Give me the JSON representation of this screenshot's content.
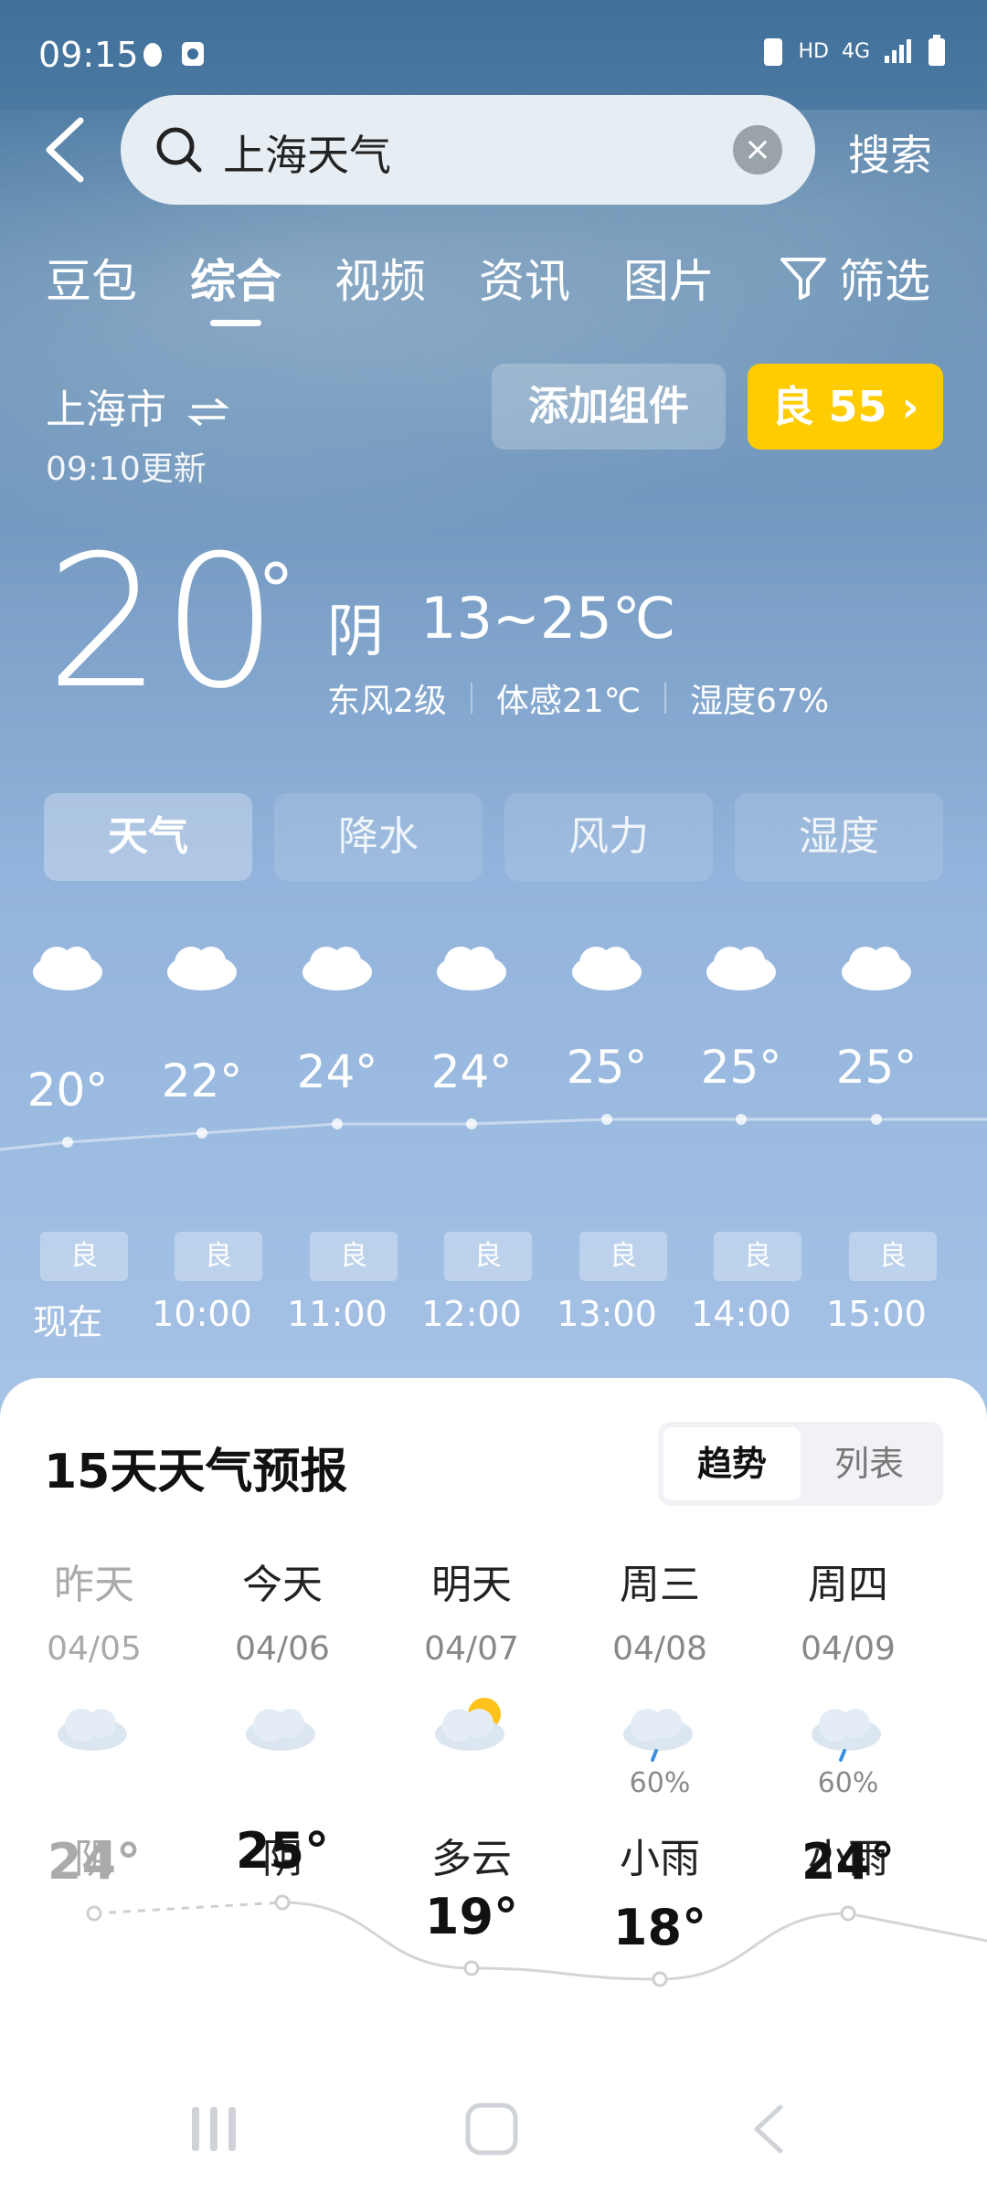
{
  "status": {
    "time": "09:15",
    "net1": "HD",
    "net2": "4G"
  },
  "search": {
    "query": "上海天气",
    "button": "搜索"
  },
  "tabs": [
    "豆包",
    "综合",
    "视频",
    "资讯",
    "图片"
  ],
  "filter_label": "筛选",
  "location": {
    "city": "上海市",
    "updated": "09:10更新"
  },
  "add_widget": "添加组件",
  "aqi": {
    "label": "良 55",
    "color": "#ffcc00"
  },
  "current": {
    "temp": "20",
    "deg": "°",
    "condition": "阴",
    "range": "13~25℃",
    "wind": "东风2级",
    "feels": "体感21℃",
    "humidity": "湿度67%"
  },
  "segments": [
    "天气",
    "降水",
    "风力",
    "湿度"
  ],
  "hourly": [
    {
      "temp": "20°",
      "aqi": "良",
      "time": "现在",
      "icon": "cloudy-icon"
    },
    {
      "temp": "22°",
      "aqi": "良",
      "time": "10:00",
      "icon": "cloudy-icon"
    },
    {
      "temp": "24°",
      "aqi": "良",
      "time": "11:00",
      "icon": "cloudy-icon"
    },
    {
      "temp": "24°",
      "aqi": "良",
      "time": "12:00",
      "icon": "cloudy-icon"
    },
    {
      "temp": "25°",
      "aqi": "良",
      "time": "13:00",
      "icon": "cloudy-icon"
    },
    {
      "temp": "25°",
      "aqi": "良",
      "time": "14:00",
      "icon": "cloudy-icon"
    },
    {
      "temp": "25°",
      "aqi": "良",
      "time": "15:00",
      "icon": "cloudy-icon"
    }
  ],
  "forecast": {
    "title": "15天天气预报",
    "toggle": [
      "趋势",
      "列表"
    ],
    "days": [
      {
        "name": "昨天",
        "date": "04/05",
        "cond": "阴",
        "high": "24°",
        "precip": "",
        "icon": "cloudy-icon"
      },
      {
        "name": "今天",
        "date": "04/06",
        "cond": "阴",
        "high": "25°",
        "precip": "",
        "icon": "cloudy-icon"
      },
      {
        "name": "明天",
        "date": "04/07",
        "cond": "多云",
        "high": "19°",
        "precip": "",
        "icon": "partly-cloudy-icon"
      },
      {
        "name": "周三",
        "date": "04/08",
        "cond": "小雨",
        "high": "18°",
        "precip": "60%",
        "icon": "light-rain-icon"
      },
      {
        "name": "周四",
        "date": "04/09",
        "cond": "小雨",
        "high": "24°",
        "precip": "60%",
        "icon": "light-rain-icon"
      }
    ]
  }
}
